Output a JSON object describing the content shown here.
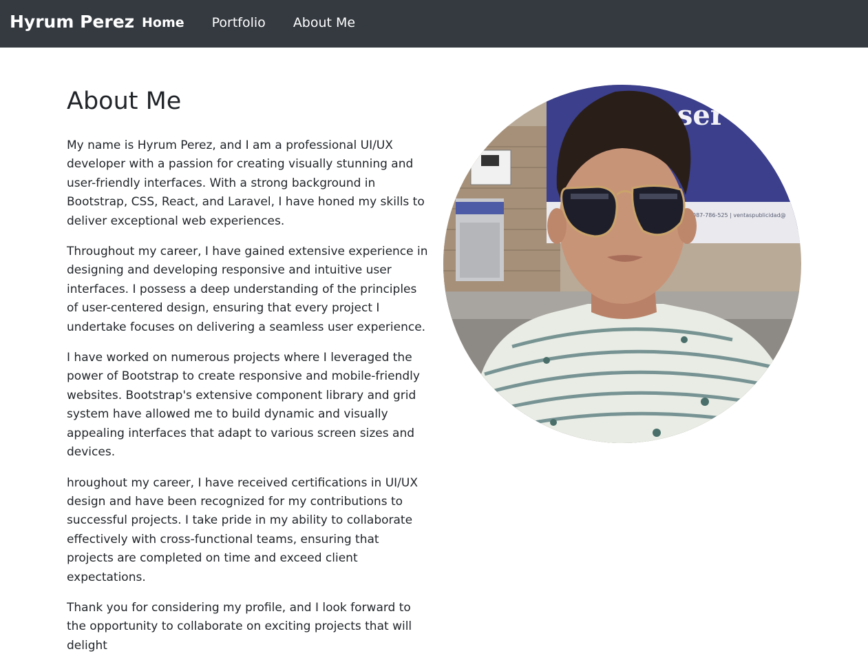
{
  "navbar": {
    "brand": "Hyrum Perez",
    "links": [
      {
        "label": "Home",
        "active": true
      },
      {
        "label": "Portfolio",
        "active": false
      },
      {
        "label": "About Me",
        "active": false
      }
    ]
  },
  "main": {
    "title": "About Me",
    "paragraphs": [
      "My name is Hyrum Perez, and I am a professional UI/UX developer with a passion for creating visually stunning and user-friendly interfaces. With a strong background in Bootstrap, CSS, React, and Laravel, I have honed my skills to deliver exceptional web experiences.",
      "Throughout my career, I have gained extensive experience in designing and developing responsive and intuitive user interfaces. I possess a deep understanding of the principles of user-centered design, ensuring that every project I undertake focuses on delivering a seamless user experience.",
      "I have worked on numerous projects where I leveraged the power of Bootstrap to create responsive and mobile-friendly websites. Bootstrap's extensive component library and grid system have allowed me to build dynamic and visually appealing interfaces that adapt to various screen sizes and devices.",
      "hroughout my career, I have received certifications in UI/UX design and have been recognized for my contributions to successful projects. I take pride in my ability to collaborate effectively with cross-functional teams, ensuring that projects are completed on time and exceed client expectations.",
      "Thank you for considering my profile, and I look forward to the opportunity to collaborate on exciting projects that will delight"
    ]
  },
  "profile_photo": {
    "sign_text": "a ser",
    "banner_small_text": "087-786-525  |  ventaspublicidad@",
    "colors": {
      "navbar_bg": "#343a40",
      "banner_blue": "#3b3f8c",
      "shirt": "#e8ece4",
      "stripe": "#6b8a8a",
      "hair": "#2a1e18",
      "skin": "#c89478"
    }
  }
}
